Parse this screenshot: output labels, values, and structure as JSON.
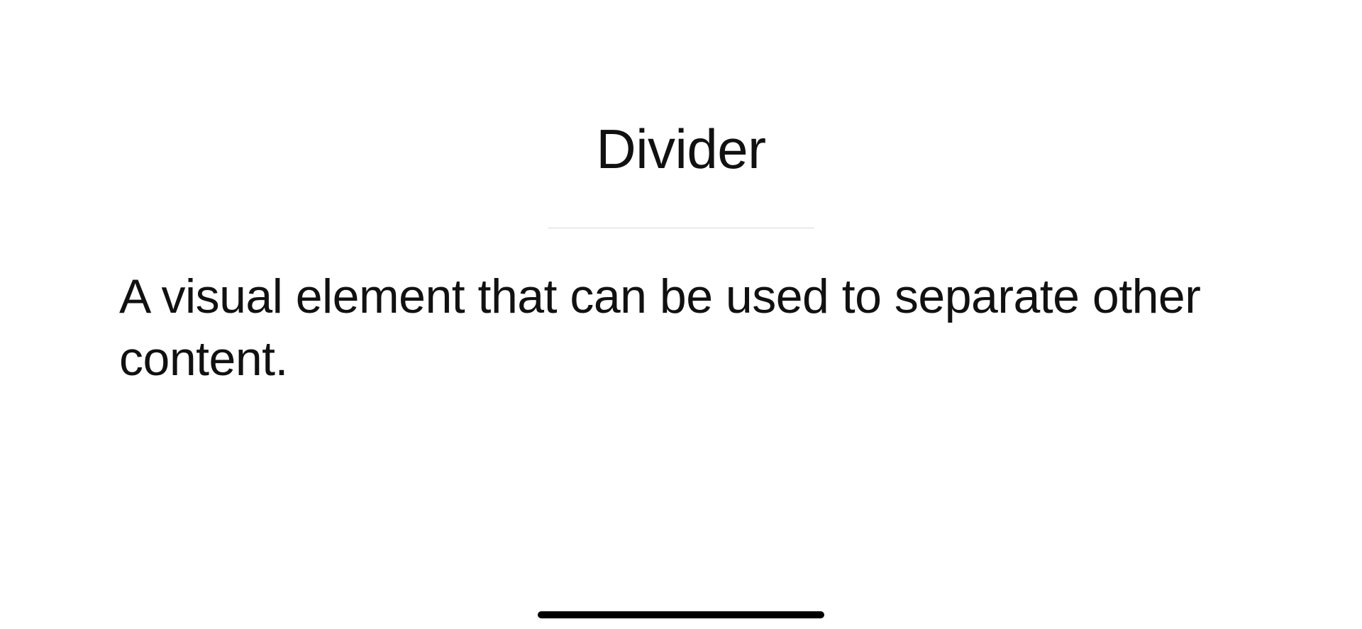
{
  "page": {
    "title": "Divider",
    "description": "A visual element that can be used to separate other content."
  }
}
